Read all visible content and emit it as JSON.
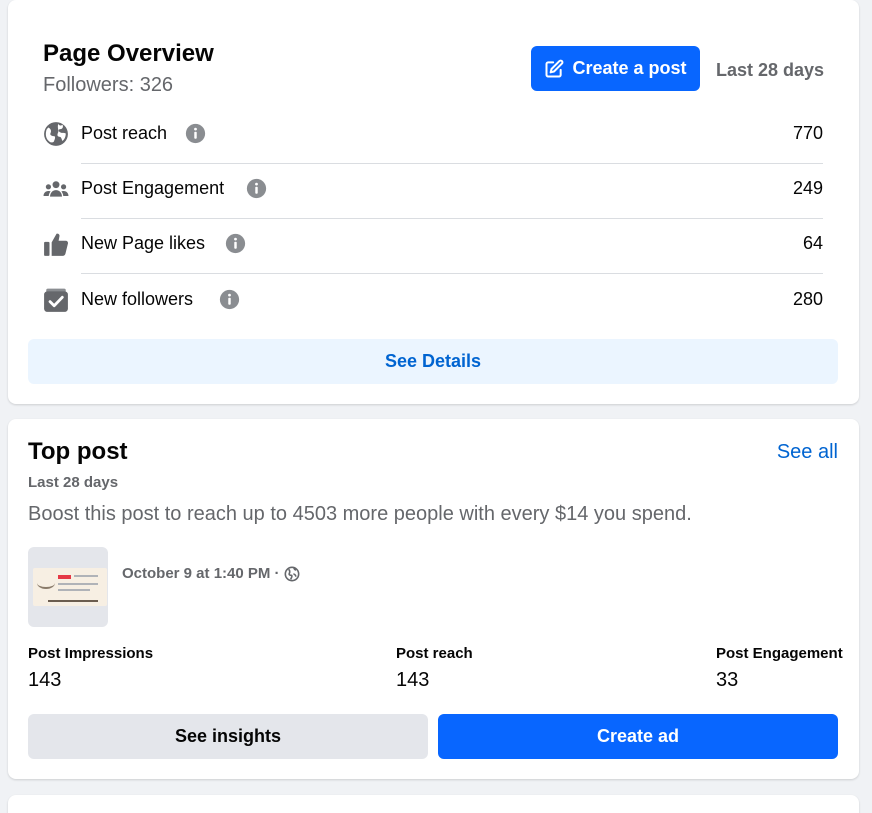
{
  "overview": {
    "title": "Page Overview",
    "followers": "Followers: 326",
    "create_post_label": "Create a post",
    "range_label": "Last 28 days",
    "metrics": [
      {
        "label": "Post reach",
        "value": "770",
        "icon": "globe-icon"
      },
      {
        "label": "Post Engagement",
        "value": "249",
        "icon": "people-icon"
      },
      {
        "label": "New Page likes",
        "value": "64",
        "icon": "thumbs-up-icon"
      },
      {
        "label": "New followers",
        "value": "280",
        "icon": "followers-icon"
      }
    ],
    "see_details_label": "See Details"
  },
  "top_post": {
    "title": "Top post",
    "see_all_label": "See all",
    "range_label": "Last 28 days",
    "boost_text": "Boost this post to reach up to 4503 more people with every $14 you spend.",
    "post_date": "October 9 at 1:40 PM ·",
    "stats": [
      {
        "label": "Post Impressions",
        "value": "143"
      },
      {
        "label": "Post reach",
        "value": "143"
      },
      {
        "label": "Post Engagement",
        "value": "33"
      }
    ],
    "see_insights_label": "See insights",
    "create_ad_label": "Create ad"
  },
  "colors": {
    "primary": "#0866ff",
    "link": "#0064d1",
    "secondary_text": "#65676b",
    "background": "#f0f2f5"
  }
}
